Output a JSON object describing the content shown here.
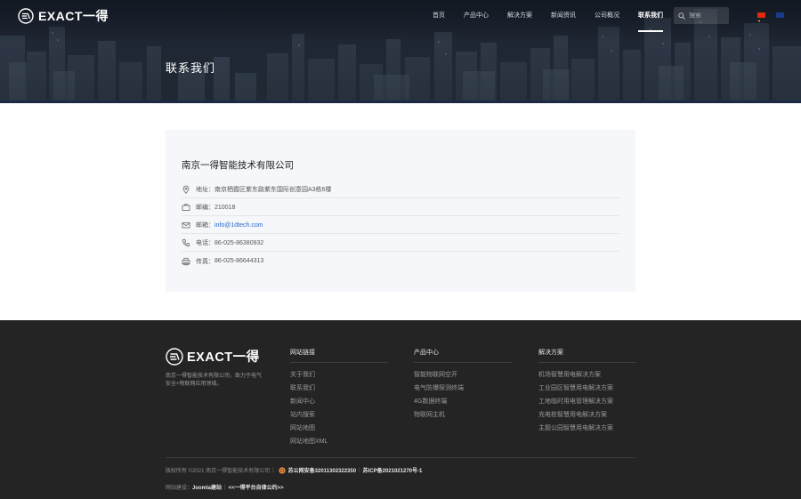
{
  "header": {
    "logo_text": "EXACT一得",
    "nav": [
      {
        "label": "首页"
      },
      {
        "label": "产品中心"
      },
      {
        "label": "解决方案"
      },
      {
        "label": "新闻资讯"
      },
      {
        "label": "公司概况"
      },
      {
        "label": "联系我们",
        "active": true
      }
    ],
    "search_placeholder": "搜索"
  },
  "hero": {
    "title": "联系我们"
  },
  "contact": {
    "company": "南京一得智能技术有限公司",
    "rows": [
      {
        "icon": "location-icon",
        "label": "地址：",
        "value": "南京栖霞区紫东路紫东国际创意园A3栋6楼"
      },
      {
        "icon": "postcode-icon",
        "label": "邮编：",
        "value": "210018"
      },
      {
        "icon": "mail-icon",
        "label": "邮箱：",
        "value": "info@1dtech.com",
        "link": true
      },
      {
        "icon": "phone-icon",
        "label": "电话：",
        "value": "86-025-86380932"
      },
      {
        "icon": "fax-icon",
        "label": "传真：",
        "value": "86-025-86644313"
      }
    ]
  },
  "footer": {
    "logo_text": "EXACT一得",
    "description": "南京一得智能技术有限公司，致力于电气安全+物联网应用领域。",
    "columns": [
      {
        "title": "网站链接",
        "links": [
          "关于我们",
          "联系我们",
          "新闻中心",
          "站内搜索",
          "网站地图",
          "网站地图XML"
        ]
      },
      {
        "title": "产品中心",
        "links": [
          "智能物联网空开",
          "电气防爆探测终端",
          "4G数据终端",
          "物联网主机"
        ]
      },
      {
        "title": "解决方案",
        "links": [
          "机场智慧用电解决方案",
          "工业园区智慧用电解决方案",
          "工地临时用电管理解决方案",
          "充电桩智慧用电解决方案",
          "主题公园智慧用电解决方案"
        ]
      }
    ],
    "copyright": "版权所有 ©2021 南京一得智能技术有限公司",
    "police_record": "苏公网安备32011302322350",
    "icp_record": "苏ICP备2021021270号-1",
    "build_label": "网站建设：",
    "build_link": "Joomla建站",
    "platform_link": "<<一得平台自律公约>>"
  },
  "colors": {
    "footer_bg": "#242424",
    "card_bg": "#f5f7fa",
    "link_blue": "#2a6ad0"
  }
}
